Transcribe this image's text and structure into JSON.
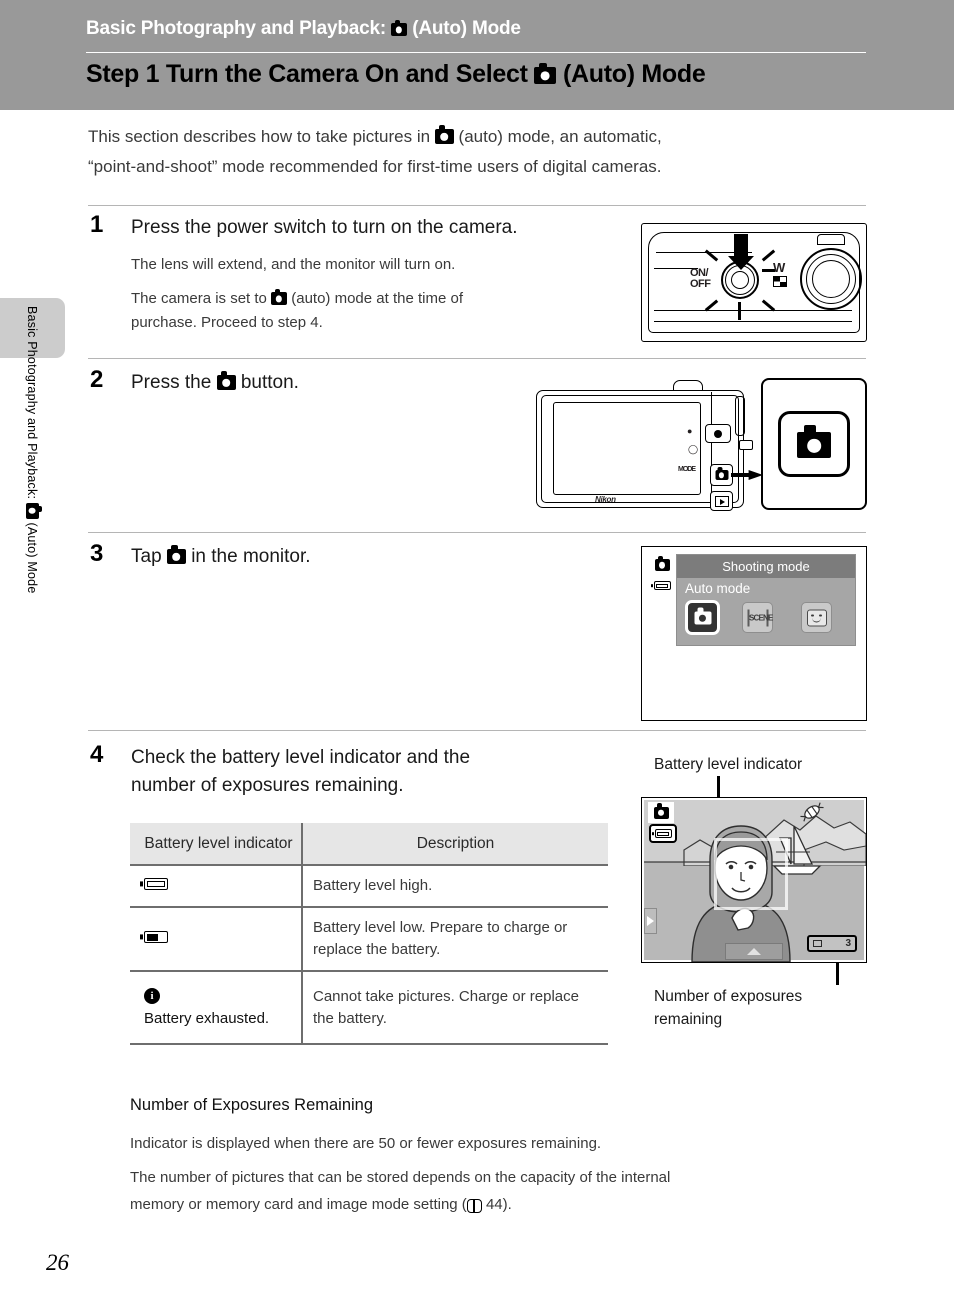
{
  "header": {
    "chapter_prefix": "Basic Photography and Playback:",
    "chapter_suffix": "(Auto) Mode",
    "step_title_prefix": "Step 1 Turn the Camera On and Select",
    "step_title_suffix": "(Auto) Mode",
    "band_color": "#999999"
  },
  "sidebar": {
    "vertical_text_prefix": "Basic Photography and Playback:",
    "vertical_text_suffix": "(Auto) Mode",
    "tab_color": "#cccccc"
  },
  "intro": {
    "line1_a": "This section describes how to take pictures in",
    "line1_b": "(auto) mode, an automatic,",
    "line2": "“point-and-shoot” mode recommended for first-time users of digital cameras."
  },
  "steps": [
    {
      "number": "1",
      "heading": "Press the power switch to turn on the camera.",
      "body1": "The lens will extend, and the monitor will turn on.",
      "body2_a": "The camera is set to",
      "body2_b": "(auto) mode at the time of",
      "body3": "purchase. Proceed to step 4."
    },
    {
      "number": "2",
      "heading_a": "Press the",
      "heading_b": "button."
    },
    {
      "number": "3",
      "heading_a": "Tap",
      "heading_b": "in the monitor."
    },
    {
      "number": "4",
      "heading_line1": "Check the battery level indicator and the",
      "heading_line2": "number of exposures remaining."
    }
  ],
  "fig_step1": {
    "power_label_line1": "ON/",
    "power_label_line2": "OFF",
    "zoom_wide_label": "W"
  },
  "fig_step2": {
    "brand": "Nikon",
    "movie_label": "●’▕",
    "flash_label": "◯ƒ",
    "mode_label": "MODE"
  },
  "fig_step3": {
    "panel_title": "Shooting mode",
    "panel_subtitle": "Auto mode",
    "modes": [
      {
        "name": "auto-mode-icon",
        "label": "",
        "selected": true
      },
      {
        "name": "scene-mode-icon",
        "label": "SCENE",
        "selected": false
      },
      {
        "name": "smart-portrait-mode-icon",
        "label": "",
        "selected": false
      }
    ]
  },
  "fig_step4": {
    "callout_top": "Battery level indicator",
    "callout_bottom_line1": "Number of exposures",
    "callout_bottom_line2": "remaining",
    "exposures_value": "3"
  },
  "table": {
    "headers": [
      "Battery level indicator",
      "Description"
    ],
    "rows": [
      {
        "icon": "battery-full-icon",
        "label": "",
        "description": "Battery level high."
      },
      {
        "icon": "battery-low-icon",
        "label": "",
        "description": "Battery level low. Prepare to charge or replace the battery."
      },
      {
        "icon": "info-icon",
        "label": "Battery exhausted.",
        "description": "Cannot take pictures. Charge or replace the battery."
      }
    ]
  },
  "notes": {
    "heading": "Number of Exposures Remaining",
    "para1": "Indicator is displayed when there are 50 or fewer exposures remaining.",
    "para2_line1": "The number of pictures that can be stored depends on the capacity of the internal",
    "para2_line2_a": "memory or memory card and image mode setting (",
    "para2_line2_b": "44)."
  },
  "page_number": "26"
}
